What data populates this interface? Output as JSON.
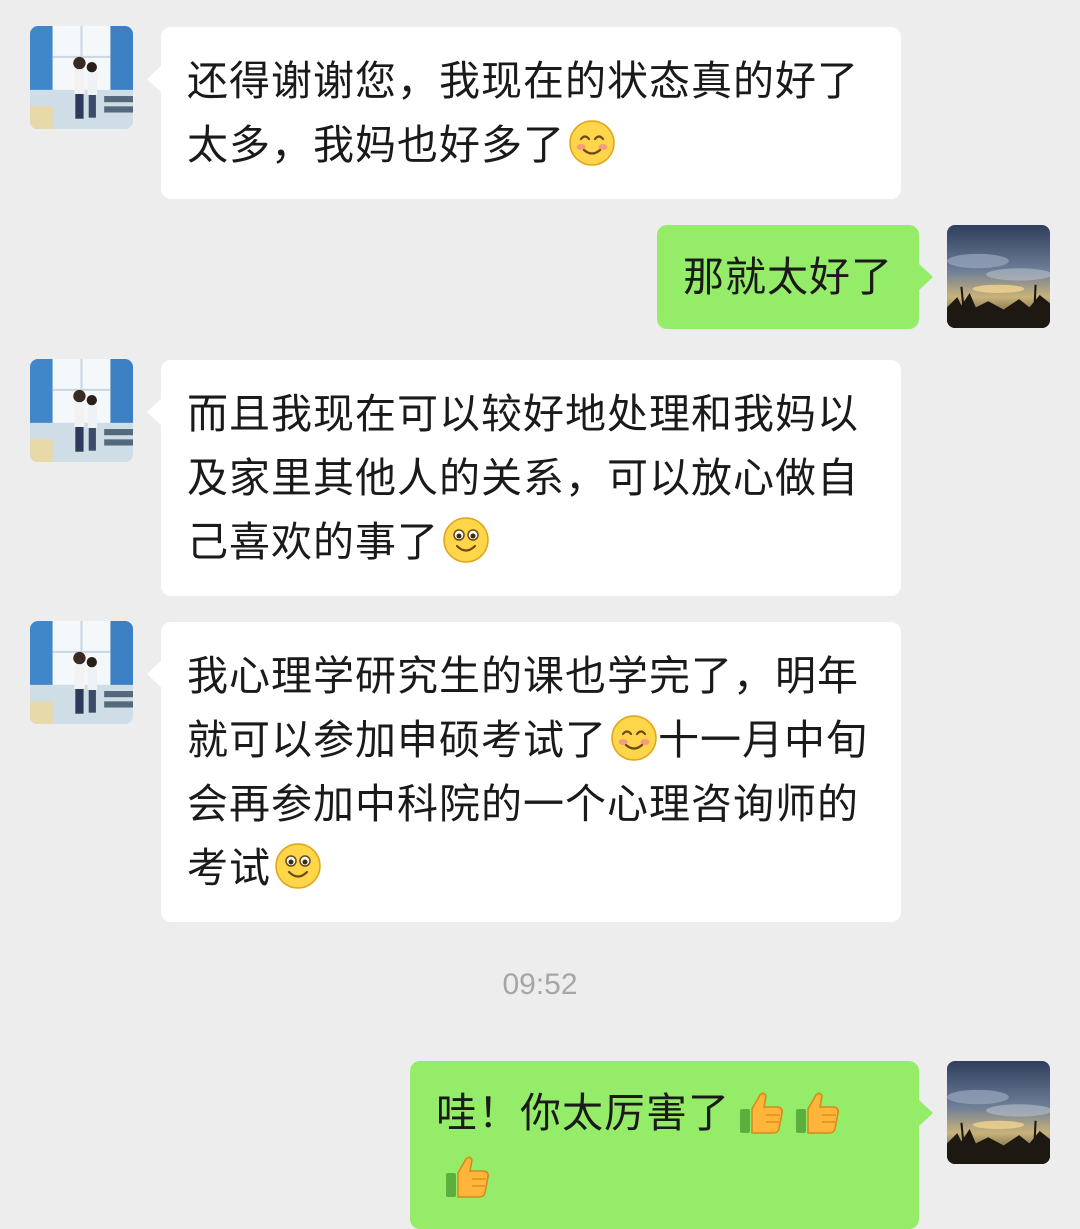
{
  "messages": [
    {
      "side": "in",
      "text": "还得谢谢您，我现在的状态真的好了太多，我妈也好多了",
      "emoji": "blush-smile-emoji"
    },
    {
      "side": "out",
      "text": "那就太好了"
    },
    {
      "side": "in",
      "text": "而且我现在可以较好地处理和我妈以及家里其他人的关系，可以放心做自己喜欢的事了",
      "emoji": "smile-emoji"
    },
    {
      "side": "in",
      "text_before": "我心理学研究生的课也学完了，明年就可以参加申硕考试了",
      "emoji_mid": "blush-smile-emoji",
      "text_after": "十一月中旬会再参加中科院的一个心理咨询师的考试",
      "emoji": "smile-emoji"
    },
    {
      "side": "out",
      "text": "哇！你太厉害了",
      "emoji": "thumbs-up-icon x3"
    }
  ],
  "timestamp": "09:52",
  "colors": {
    "background": "#ededed",
    "incoming_bubble": "#ffffff",
    "outgoing_bubble": "#95ec69",
    "timestamp": "#a6a6a6"
  }
}
